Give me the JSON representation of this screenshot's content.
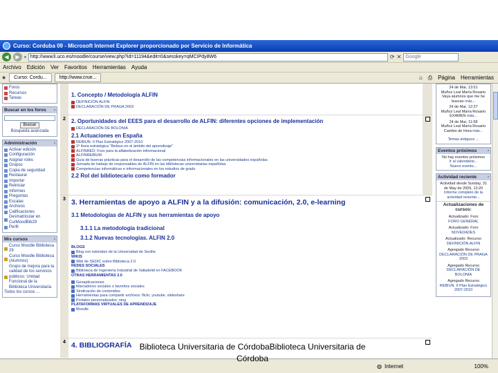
{
  "window": {
    "title": "Curso: Corduba 09 - Microsoft Internet Explorer proporcionado por Servicio de Informática",
    "url": "http://www3.uco.es/moodle/course/view.php?id=11194&edit=0&sesskey=qMCIPdy8W6",
    "search_placeholder": "Google"
  },
  "menu": [
    "Archivo",
    "Edición",
    "Ver",
    "Favoritos",
    "Herramientas",
    "Ayuda"
  ],
  "tabs": [
    "Curso: Cordu...",
    "http://www.crue..."
  ],
  "tab_tools": {
    "page": "Página",
    "tools": "Herramientas"
  },
  "left": {
    "top_items": [
      "Foros",
      "Recursos",
      "Tareas"
    ],
    "search": {
      "title": "Buscar en los foros",
      "button": "Buscar",
      "advanced": "Búsqueda avanzada"
    },
    "admin": {
      "title": "Administración",
      "items": [
        "Activar edición",
        "Configuración",
        "Asignar roles",
        "Grupos",
        "Copia de seguridad",
        "Restaurar",
        "Importar",
        "Reiniciar",
        "Informes",
        "Preguntas",
        "Escalas",
        "Archivos",
        "Calificaciones",
        "Desmatricular en CurMoodBib29",
        "Perfil"
      ]
    },
    "courses": {
      "title": "Mis cursos",
      "items": [
        "Curso Moodle Biblioteca 29",
        "Curso Moodle Biblioteca (Alumnos)",
        "Grupo de mejora para la calidad de los servicios públicos: Unidad Funcional de la Biblioteca Universitaria"
      ],
      "all": "Todos los cursos ..."
    }
  },
  "topics": {
    "t1": {
      "title": "1. Concepto / Metodología ALFIN",
      "items": [
        "DEFINICIÓN ALFIN",
        "DECLARACIÓN DE PRAGA 2003"
      ]
    },
    "t2": {
      "num": "2",
      "title": "2. Oportunidades del EEES para el desarrollo de ALFIN: diferentes opciones de implementación",
      "first_item": "DECLARACIÓN DE BOLONIA",
      "sub1": "2.1 Actuaciones en España",
      "items": [
        "REBIUN. II Plan Estratégico 2007-2010",
        "1ª línea estratégica \"Rebiun en el ámbito del aprendizaje\"",
        "ALFINRED: Foro para la alfabetización informacional",
        "ALFINREBIUM",
        "Guía de buenas prácticas para el desarrollo de las competencias informacionales en las universidades españolas",
        "Jornada de trabajo de responsables de ALFIN en las bibliotecas universitarias españolas",
        "Competencias informáticas e informacionales en los estudios de grado"
      ],
      "sub2": "2.2 Rol del bibliotecario como formador"
    },
    "t3": {
      "num": "3",
      "title": "3. Herramientas de apoyo a ALFIN y a la difusión: comunicación, 2.0, e-learning",
      "sub1": "3.1 Metodologías de ALFIN y sus herramientas de apoyo",
      "sub11": "3.1.1 La metodología tradicional",
      "sub12": "3.1.2 Nuevas tecnologías. ALFIN 2.0",
      "blogs": "BLOGS",
      "blog_item": "Blog con tutoriales de la Universidad de Sevilla",
      "wikis": "WIKIS",
      "wiki_item": "Wiki de SEDIC sobre Biblioteca 2.0",
      "redes": "REDES SOCIALES",
      "redes_item": "Biblioteca de Ingeniería Industrial de Valladolid en FACEBOOK",
      "otras": "OTRAS HERRAMIENTAS 2.0",
      "otras_items": [
        "Geoaplicaciones",
        "Marcadores sociales o favoritos sociales",
        "Sindicación de contenidos",
        "Herramientas para compartir archivos: flickr, youtube, slideshare",
        "Portales personalizados: ning"
      ],
      "plataformas": "PLATAFORMAS VIRTUALES DE APRENDIZAJE",
      "moodle": "Moodle"
    },
    "t4": {
      "num": "4",
      "title": "4. BIBLIOGRAFÍA"
    }
  },
  "right": {
    "news": [
      {
        "date": "24 de Mar, 13:51",
        "author": "Muñoz Leal María Rosario",
        "text": "Vaya alumnos que me he buscao",
        "more": "más..."
      },
      {
        "date": "24 de Mar, 12:27",
        "author": "Muñoz Leal María Rosario",
        "text": "EXAMEN",
        "more": "más..."
      },
      {
        "date": "24 de Mar, 11:58",
        "author": "Muñoz Leal María Rosario",
        "text": "Cambio de Hora",
        "more": "más..."
      }
    ],
    "old_topics": "Temas antiguos ...",
    "events": {
      "title": "Eventos próximos",
      "none": "No hay eventos próximos",
      "calendar": "Ir al calendario...",
      "new": "Nuevo evento..."
    },
    "activity": {
      "title": "Actividad reciente",
      "since": "Actividad desde Sunday, 31 de May de 2009, 13:20",
      "report": "Informe completo de la actividad reciente...",
      "updates_title": "Actualizaciones de cursos:",
      "entries": [
        {
          "kind": "Actualizado: Foro",
          "name": "FORO GENERAL"
        },
        {
          "kind": "Actualizado: Foro",
          "name": "NOVEDADES"
        },
        {
          "kind": "Actualizado: Recurso",
          "name": "DEFINICIÓN ALFIN"
        },
        {
          "kind": "Agregado Recurso",
          "name": "DECLARACIÓN DE PRAGA 2003"
        },
        {
          "kind": "Agregado Recurso",
          "name": "DECLARACIÓN DE BOLONIA"
        },
        {
          "kind": "Agregado Recurso",
          "name": "REBIUN. II Plan Estratégico 2007-2010"
        }
      ]
    }
  },
  "status": {
    "zone": "Internet",
    "zoom": "100%"
  },
  "caption": "Biblioteca Universitaria de CórdobaBiblioteca Universitaria de Córdoba"
}
